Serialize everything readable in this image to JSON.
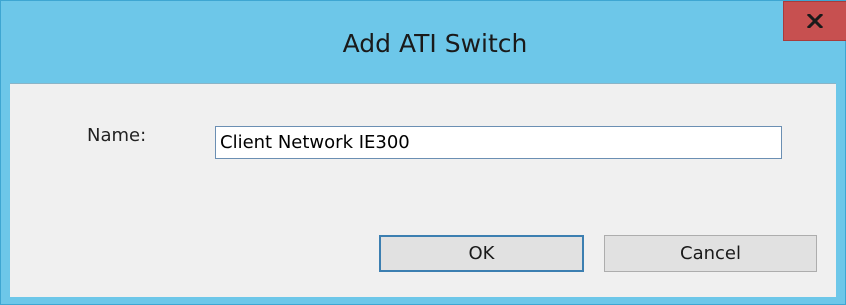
{
  "window": {
    "title": "Add ATI Switch",
    "close_icon": "close-x-icon",
    "colors": {
      "titlebar": "#6dc7e9",
      "close_button": "#c75050",
      "client_background": "#f0f0f0"
    }
  },
  "form": {
    "name_label": "Name:",
    "name_value": "Client Network IE300"
  },
  "buttons": {
    "ok_label": "OK",
    "cancel_label": "Cancel"
  }
}
